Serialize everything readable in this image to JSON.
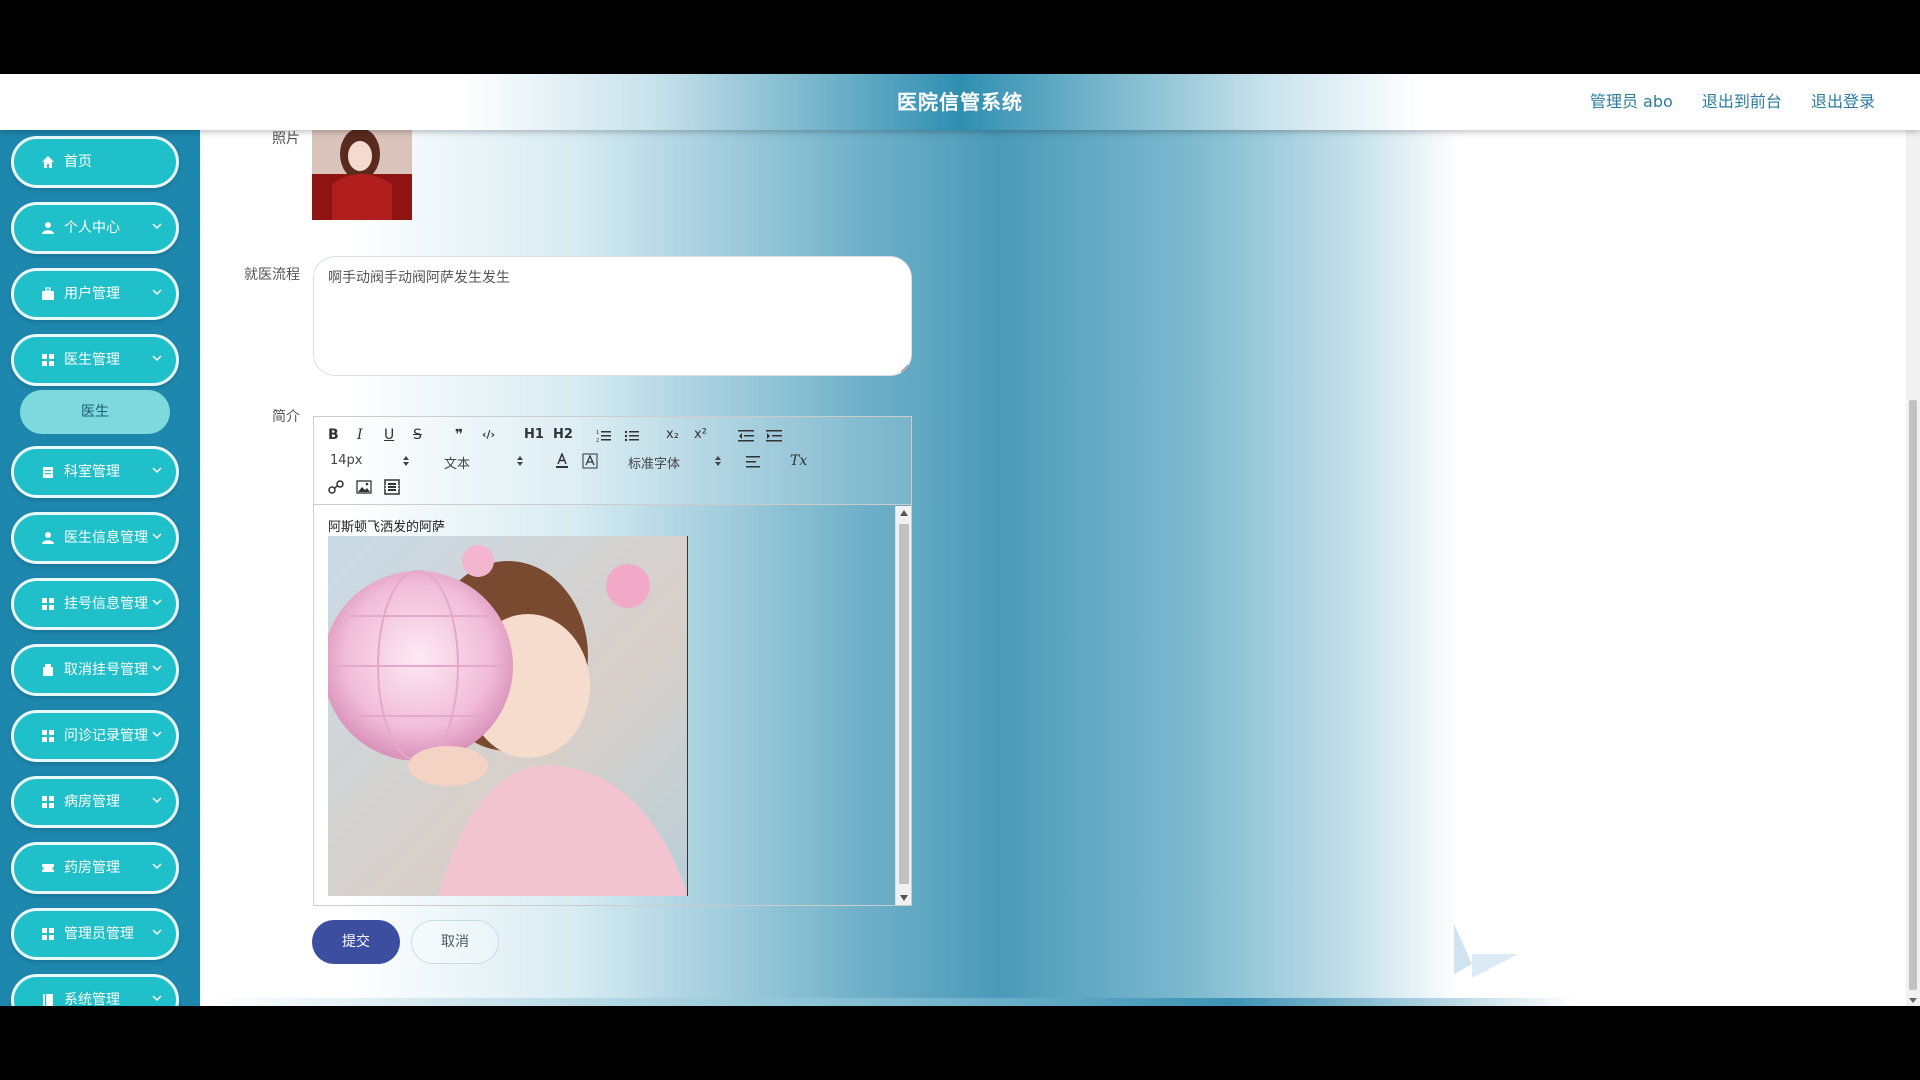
{
  "header": {
    "title": "医院信管系统",
    "user": "管理员 abo",
    "front_link": "退出到前台",
    "logout_link": "退出登录"
  },
  "sidebar": {
    "items": [
      {
        "label": "首页",
        "icon": "home-icon"
      },
      {
        "label": "个人中心",
        "icon": "user-icon"
      },
      {
        "label": "用户管理",
        "icon": "briefcase-icon"
      },
      {
        "label": "医生管理",
        "icon": "grid-icon"
      },
      {
        "label": "科室管理",
        "icon": "clipboard-icon"
      },
      {
        "label": "医生信息管理",
        "icon": "user-icon"
      },
      {
        "label": "挂号信息管理",
        "icon": "grid-icon"
      },
      {
        "label": "取消挂号管理",
        "icon": "bookmark-icon"
      },
      {
        "label": "问诊记录管理",
        "icon": "grid-icon"
      },
      {
        "label": "病房管理",
        "icon": "grid-icon"
      },
      {
        "label": "药房管理",
        "icon": "ticket-icon"
      },
      {
        "label": "管理员管理",
        "icon": "grid-icon"
      },
      {
        "label": "系统管理",
        "icon": "book-icon"
      }
    ],
    "sub_item": "医生"
  },
  "form": {
    "photo_label": "照片",
    "process_label": "就医流程",
    "process_value": "啊手动阀手动阀阿萨发生发生",
    "intro_label": "简介",
    "intro_text": "阿斯顿飞洒发的阿萨",
    "submit": "提交",
    "cancel": "取消"
  },
  "editor_toolbar": {
    "bold": "B",
    "italic": "I",
    "underline": "U",
    "strike": "S",
    "quote": "❞",
    "code": "‹/›",
    "h1": "H1",
    "h2": "H2",
    "sub": "x₂",
    "sup": "x²",
    "size": "14px",
    "header": "文本",
    "font": "标准字体",
    "clean": "Tx"
  },
  "colors": {
    "sidebar_bg": "#1e87ad",
    "nav_btn": "#1fc0c9",
    "sub_btn": "#7dd9dd",
    "submit_btn": "#3c4ea0",
    "link": "#2b7da0"
  }
}
